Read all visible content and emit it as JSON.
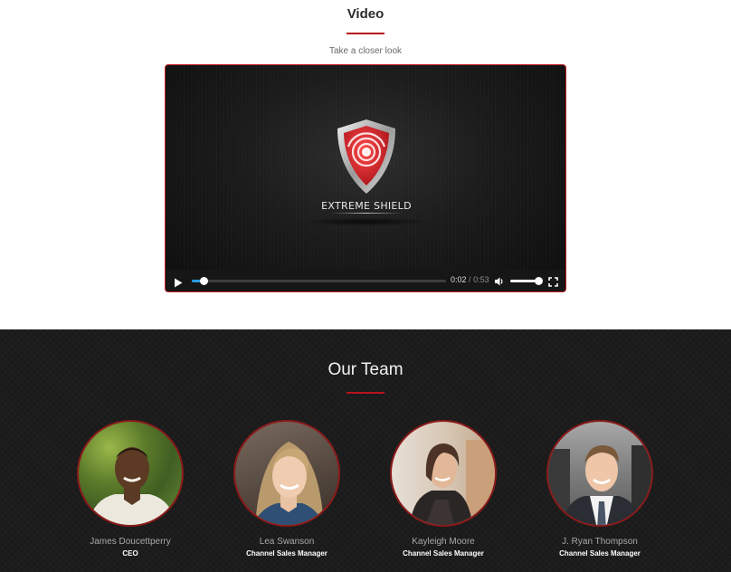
{
  "video": {
    "title": "Video",
    "subtitle": "Take a closer look",
    "brand": "EXTREME SHIELD",
    "current_time": "0:02",
    "separator": "/",
    "duration": "0:53",
    "progress_fraction": 0.045,
    "volume_fraction": 1.0,
    "accent_color": "#c21a22",
    "progress_color": "#2a9be0",
    "icons": [
      "play-icon",
      "volume-icon",
      "fullscreen-icon",
      "shield-logo-icon"
    ]
  },
  "team": {
    "title": "Our Team",
    "members": [
      {
        "name": "James Doucettperry",
        "role": "CEO"
      },
      {
        "name": "Lea Swanson",
        "role": "Channel Sales Manager"
      },
      {
        "name": "Kayleigh Moore",
        "role": "Channel Sales Manager"
      },
      {
        "name": "J. Ryan Thompson",
        "role": "Channel Sales Manager"
      }
    ]
  }
}
